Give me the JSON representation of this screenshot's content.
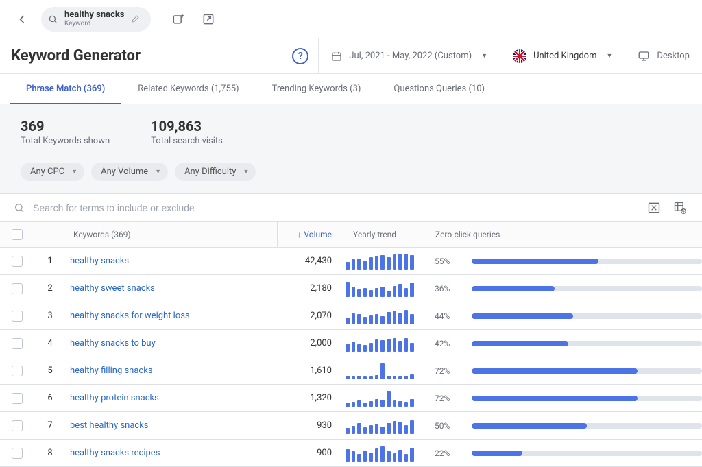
{
  "header_search": {
    "value": "healthy snacks",
    "subtype": "Keyword"
  },
  "page_title": "Keyword Generator",
  "date_range": "Jul, 2021 - May, 2022 (Custom)",
  "country": "United Kingdom",
  "device": "Desktop",
  "tabs": [
    {
      "label": "Phrase Match (369)",
      "active": true
    },
    {
      "label": "Related Keywords (1,755)",
      "active": false
    },
    {
      "label": "Trending Keywords (3)",
      "active": false
    },
    {
      "label": "Questions Queries (10)",
      "active": false
    }
  ],
  "stats": {
    "total_keywords": {
      "value": "369",
      "label": "Total Keywords shown"
    },
    "total_visits": {
      "value": "109,863",
      "label": "Total search visits"
    }
  },
  "filters": [
    {
      "name": "cpc",
      "label": "Any CPC"
    },
    {
      "name": "volume",
      "label": "Any Volume"
    },
    {
      "name": "difficulty",
      "label": "Any Difficulty"
    }
  ],
  "search_placeholder": "Search for terms to include or exclude",
  "columns": {
    "keywords": "Keywords (369)",
    "volume": "Volume",
    "trend": "Yearly trend",
    "zcq": "Zero-click queries"
  },
  "rows": [
    {
      "n": 1,
      "keyword": "healthy snacks",
      "volume": "42,430",
      "zcq": 55,
      "spark": [
        40,
        55,
        62,
        50,
        70,
        78,
        85,
        72,
        88,
        92,
        95,
        82
      ]
    },
    {
      "n": 2,
      "keyword": "healthy sweet snacks",
      "volume": "2,180",
      "zcq": 36,
      "spark": [
        90,
        55,
        40,
        50,
        35,
        50,
        55,
        30,
        60,
        75,
        50,
        85
      ]
    },
    {
      "n": 3,
      "keyword": "healthy snacks for weight loss",
      "volume": "2,070",
      "zcq": 44,
      "spark": [
        35,
        60,
        55,
        40,
        50,
        55,
        45,
        70,
        80,
        65,
        85,
        55
      ]
    },
    {
      "n": 4,
      "keyword": "healthy snacks to buy",
      "volume": "2,000",
      "zcq": 42,
      "spark": [
        45,
        55,
        40,
        35,
        50,
        70,
        65,
        75,
        80,
        60,
        80,
        50
      ]
    },
    {
      "n": 5,
      "keyword": "healthy filling snacks",
      "volume": "1,610",
      "zcq": 72,
      "spark": [
        10,
        8,
        12,
        9,
        7,
        15,
        95,
        10,
        12,
        8,
        10,
        22
      ]
    },
    {
      "n": 6,
      "keyword": "healthy protein snacks",
      "volume": "1,320",
      "zcq": 72,
      "spark": [
        15,
        22,
        30,
        18,
        25,
        40,
        35,
        95,
        30,
        25,
        22,
        38
      ]
    },
    {
      "n": 7,
      "keyword": "best healthy snacks",
      "volume": "930",
      "zcq": 50,
      "spark": [
        30,
        45,
        60,
        35,
        50,
        55,
        40,
        60,
        75,
        70,
        50,
        80
      ]
    },
    {
      "n": 8,
      "keyword": "healthy snacks recipes",
      "volume": "900",
      "zcq": 22,
      "spark": [
        70,
        55,
        40,
        60,
        50,
        75,
        90,
        55,
        45,
        65,
        40,
        80
      ]
    }
  ]
}
